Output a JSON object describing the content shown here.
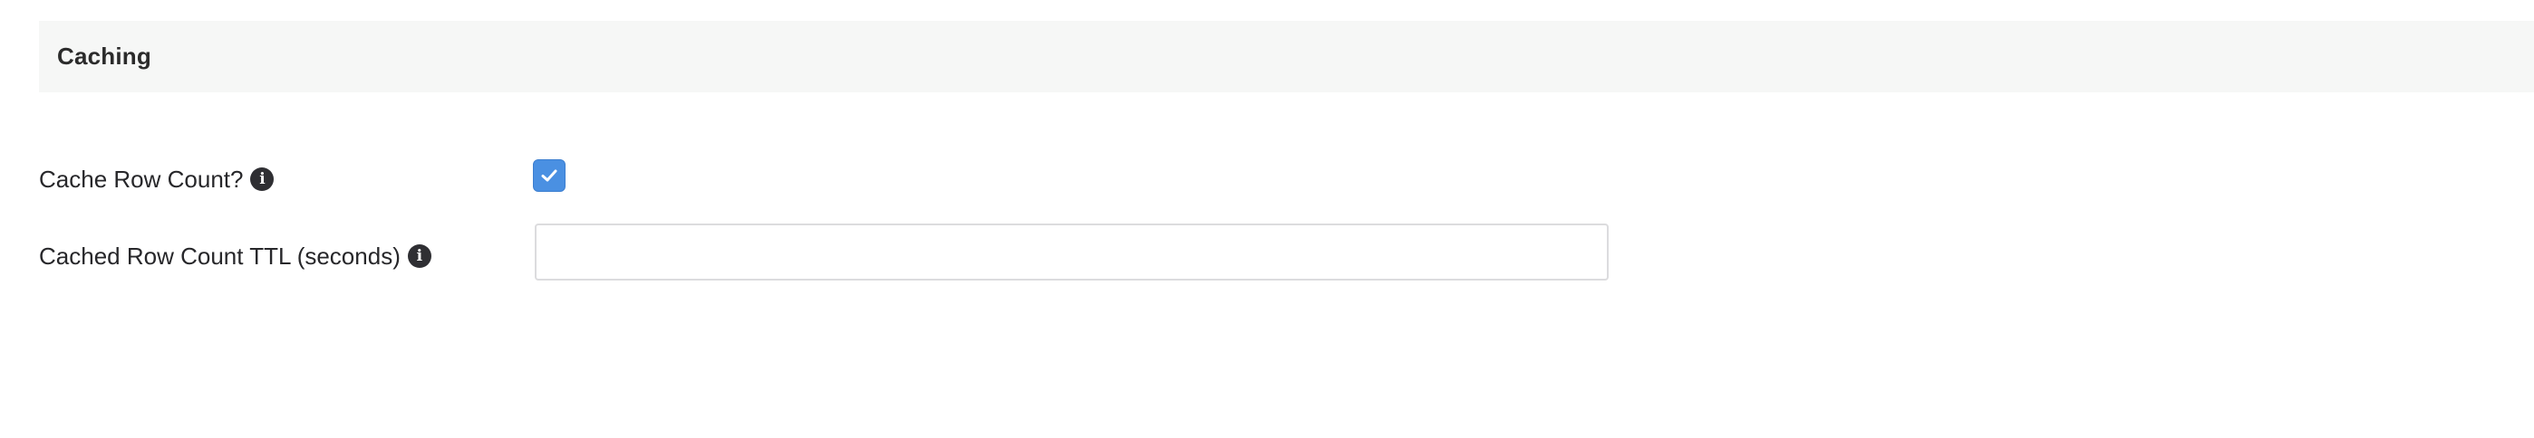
{
  "section": {
    "title": "Caching"
  },
  "fields": {
    "cache_row_count": {
      "label": "Cache Row Count?",
      "info_icon": "info-icon",
      "checked": true
    },
    "cached_row_count_ttl": {
      "label": "Cached Row Count TTL (seconds)",
      "info_icon": "info-icon",
      "value": "",
      "placeholder": ""
    }
  },
  "colors": {
    "checkbox_accent": "#4a90e2",
    "header_background": "#f6f7f6",
    "info_icon_background": "#2f2f33"
  }
}
